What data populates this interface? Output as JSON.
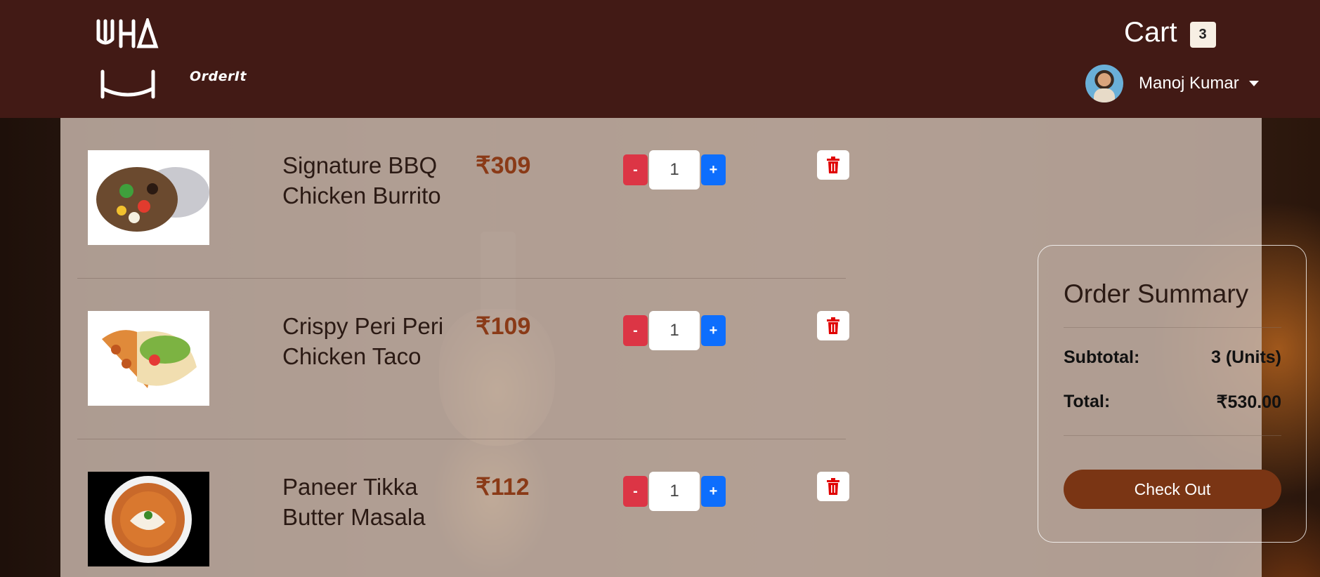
{
  "brand": {
    "logo_text": "OrderIt"
  },
  "header": {
    "cart_label": "Cart",
    "cart_count": "3",
    "user_name": "Manoj Kumar"
  },
  "cart": {
    "items": [
      {
        "name": "Signature BBQ Chicken Burrito",
        "price": "₹309",
        "quantity": "1",
        "minus_label": "-",
        "plus_label": "+"
      },
      {
        "name": "Crispy Peri Peri Chicken Taco",
        "price": "₹109",
        "quantity": "1",
        "minus_label": "-",
        "plus_label": "+"
      },
      {
        "name": "Paneer Tikka Butter Masala",
        "price": "₹112",
        "quantity": "1",
        "minus_label": "-",
        "plus_label": "+"
      }
    ]
  },
  "summary": {
    "title": "Order Summary",
    "subtotal_label": "Subtotal:",
    "subtotal_value": "3 (Units)",
    "total_label": "Total:",
    "total_value": "₹530.00",
    "checkout_label": "Check Out"
  },
  "colors": {
    "navbar": "#421a15",
    "price": "#8a3a17",
    "checkout": "#7a3514",
    "minus": "#dc3545",
    "plus": "#0d6efd",
    "delete": "#e00000"
  }
}
